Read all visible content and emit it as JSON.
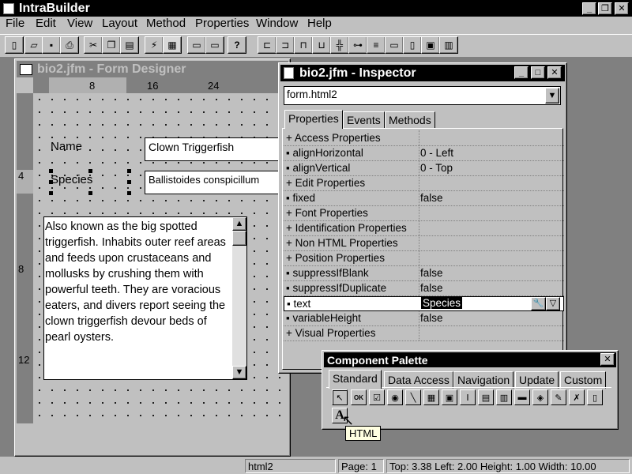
{
  "app": {
    "title": "IntraBuilder"
  },
  "menu": [
    "File",
    "Edit",
    "View",
    "Layout",
    "Method",
    "Properties",
    "Window",
    "Help"
  ],
  "form_designer": {
    "title": "bio2.jfm - Form Designer",
    "ruler_h": [
      "8",
      "16",
      "24"
    ],
    "ruler_v": [
      "4",
      "8",
      "12"
    ],
    "name_label": "Name",
    "name_value": "Clown Triggerfish",
    "species_label": "Species",
    "species_value": "Ballistoides conspicillum",
    "description": "Also known as the big spotted triggerfish.  Inhabits outer reef areas and feeds upon crustaceans and mollusks by crushing them with powerful teeth.  They are voracious eaters, and divers report seeing the clown triggerfish devour beds of pearl oysters."
  },
  "inspector": {
    "title": "bio2.jfm - Inspector",
    "object_select": "form.html2",
    "tabs": [
      "Properties",
      "Events",
      "Methods"
    ],
    "rows": [
      {
        "name": "+ Access Properties",
        "value": ""
      },
      {
        "name": "▪ alignHorizontal",
        "value": "0 - Left"
      },
      {
        "name": "▪ alignVertical",
        "value": "0 - Top"
      },
      {
        "name": "+ Edit Properties",
        "value": ""
      },
      {
        "name": "▪ fixed",
        "value": "false"
      },
      {
        "name": "+ Font Properties",
        "value": ""
      },
      {
        "name": "+ Identification Properties",
        "value": ""
      },
      {
        "name": "+ Non HTML Properties",
        "value": ""
      },
      {
        "name": "+ Position Properties",
        "value": ""
      },
      {
        "name": "▪ suppressIfBlank",
        "value": "false"
      },
      {
        "name": "▪ suppressIfDuplicate",
        "value": "false"
      },
      {
        "name": "▪ text",
        "value": "Species"
      },
      {
        "name": "▪ variableHeight",
        "value": "false"
      },
      {
        "name": "+ Visual Properties",
        "value": ""
      }
    ]
  },
  "palette": {
    "title": "Component Palette",
    "tabs": [
      "Standard",
      "Data Access",
      "Navigation",
      "Update",
      "Custom"
    ],
    "tooltip": "HTML"
  },
  "status": {
    "object": "html2",
    "page": "Page: 1",
    "position": "Top: 3.38 Left: 2.00 Height: 1.00 Width: 10.00"
  }
}
